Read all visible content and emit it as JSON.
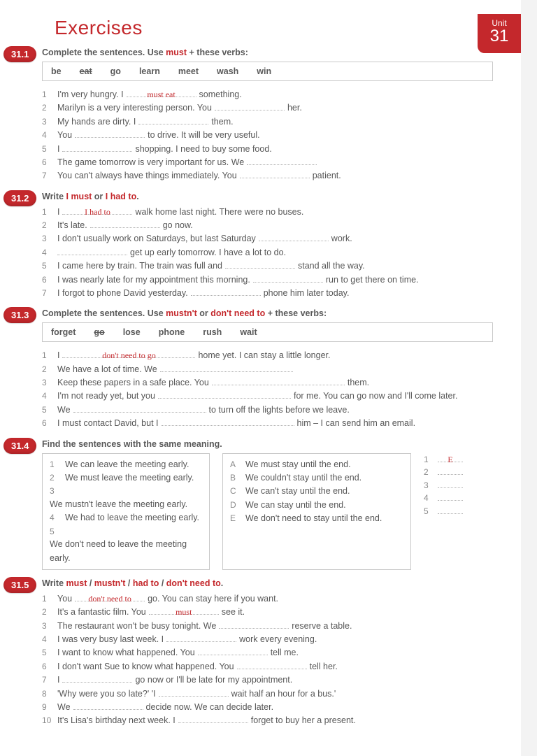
{
  "page_title": "Exercises",
  "unit": {
    "label": "Unit",
    "number": "31"
  },
  "s311": {
    "badge": "31.1",
    "instr_pre": "Complete the sentences.  Use ",
    "instr_bold": "must",
    "instr_post": " + these verbs:",
    "verbs": [
      "be",
      "eat",
      "go",
      "learn",
      "meet",
      "wash",
      "win"
    ],
    "items": [
      {
        "n": "1",
        "a": "I'm very hungry.  I",
        "ans": "must eat",
        "b": "something."
      },
      {
        "n": "2",
        "a": "Marilyn is a very interesting person.  You",
        "ans": "",
        "b": "her."
      },
      {
        "n": "3",
        "a": "My hands are dirty.  I",
        "ans": "",
        "b": "them."
      },
      {
        "n": "4",
        "a": "You",
        "ans": "",
        "b": "to drive.  It will be very useful."
      },
      {
        "n": "5",
        "a": "I",
        "ans": "",
        "b": "shopping.  I need to buy some food."
      },
      {
        "n": "6",
        "a": "The game tomorrow is very important for us.  We",
        "ans": "",
        "b": ""
      },
      {
        "n": "7",
        "a": "You can't always have things immediately.  You",
        "ans": "",
        "b": "patient."
      }
    ]
  },
  "s312": {
    "badge": "31.2",
    "instr_pre": "Write ",
    "instr_b1": "I must",
    "instr_mid": " or ",
    "instr_b2": "I had to",
    "instr_post": ".",
    "items": [
      {
        "n": "1",
        "a": "I",
        "ans": "I had to",
        "b": "walk home last night.  There were no buses."
      },
      {
        "n": "2",
        "a": "It's late.",
        "ans": "",
        "b": "go now."
      },
      {
        "n": "3",
        "a": "I don't usually work on Saturdays, but last Saturday",
        "ans": "",
        "b": "work."
      },
      {
        "n": "4",
        "a": "",
        "ans": "",
        "b": "get up early tomorrow.  I have a lot to do."
      },
      {
        "n": "5",
        "a": "I came here by train.  The train was full and",
        "ans": "",
        "b": "stand all the way."
      },
      {
        "n": "6",
        "a": "I was nearly late for my appointment this morning.",
        "ans": "",
        "b": "run to get there on time."
      },
      {
        "n": "7",
        "a": "I forgot to phone David yesterday.",
        "ans": "",
        "b": "phone him later today."
      }
    ]
  },
  "s313": {
    "badge": "31.3",
    "instr_pre": "Complete the sentences.  Use ",
    "instr_b1": "mustn't",
    "instr_mid": " or ",
    "instr_b2": "don't need to",
    "instr_post": " + these verbs:",
    "verbs": [
      "forget",
      "go",
      "lose",
      "phone",
      "rush",
      "wait"
    ],
    "items": [
      {
        "n": "1",
        "a": "I",
        "ans": "don't need to go",
        "b": "home yet.  I can stay a little longer."
      },
      {
        "n": "2",
        "a": "We have a lot of time.  We",
        "ans": "",
        "b": ""
      },
      {
        "n": "3",
        "a": "Keep these papers in a safe place.  You",
        "ans": "",
        "b": "them."
      },
      {
        "n": "4",
        "a": "I'm not ready yet, but you",
        "ans": "",
        "b": "for me.  You can go now and I'll come later."
      },
      {
        "n": "5",
        "a": "We",
        "ans": "",
        "b": "to turn off the lights before we leave."
      },
      {
        "n": "6",
        "a": "I must contact David, but I",
        "ans": "",
        "b": "him – I can send him an email."
      }
    ]
  },
  "s314": {
    "badge": "31.4",
    "instr": "Find the sentences with the same meaning.",
    "left": [
      {
        "n": "1",
        "t": "We can leave the meeting early."
      },
      {
        "n": "2",
        "t": "We must leave the meeting early."
      },
      {
        "n": "3",
        "t": "We mustn't leave the meeting early."
      },
      {
        "n": "4",
        "t": "We had to leave the meeting early."
      },
      {
        "n": "5",
        "t": "We don't need to leave the meeting early."
      }
    ],
    "right": [
      {
        "n": "A",
        "t": "We must stay until the end."
      },
      {
        "n": "B",
        "t": "We couldn't stay until the end."
      },
      {
        "n": "C",
        "t": "We can't stay until the end."
      },
      {
        "n": "D",
        "t": "We can stay until the end."
      },
      {
        "n": "E",
        "t": "We don't need to stay until the end."
      }
    ],
    "answers": [
      {
        "n": "1",
        "a": "E"
      },
      {
        "n": "2",
        "a": ""
      },
      {
        "n": "3",
        "a": ""
      },
      {
        "n": "4",
        "a": ""
      },
      {
        "n": "5",
        "a": ""
      }
    ]
  },
  "s315": {
    "badge": "31.5",
    "instr_pre": "Write ",
    "w1": "must",
    "w2": "mustn't",
    "w3": "had to",
    "w4": "don't need to",
    "items": [
      {
        "n": "1",
        "a": "You",
        "ans": "don't need to",
        "b": "go.  You can stay here if you want."
      },
      {
        "n": "2",
        "a": "It's a fantastic film.  You",
        "ans": "must",
        "b": "see it."
      },
      {
        "n": "3",
        "a": "The restaurant won't be busy tonight.  We",
        "ans": "",
        "b": "reserve a table."
      },
      {
        "n": "4",
        "a": "I was very busy last week.  I",
        "ans": "",
        "b": "work every evening."
      },
      {
        "n": "5",
        "a": "I want to know what happened.  You",
        "ans": "",
        "b": "tell me."
      },
      {
        "n": "6",
        "a": "I don't want Sue to know what happened.  You",
        "ans": "",
        "b": "tell her."
      },
      {
        "n": "7",
        "a": "I",
        "ans": "",
        "b": "go now or I'll be late for my appointment."
      },
      {
        "n": "8",
        "a": "'Why were you so late?'   'I",
        "ans": "",
        "b": "wait half an hour for a bus.'"
      },
      {
        "n": "9",
        "a": "We",
        "ans": "",
        "b": "decide now.  We can decide later."
      },
      {
        "n": "10",
        "a": "It's Lisa's birthday next week.  I",
        "ans": "",
        "b": "forget to buy her a present."
      }
    ]
  }
}
